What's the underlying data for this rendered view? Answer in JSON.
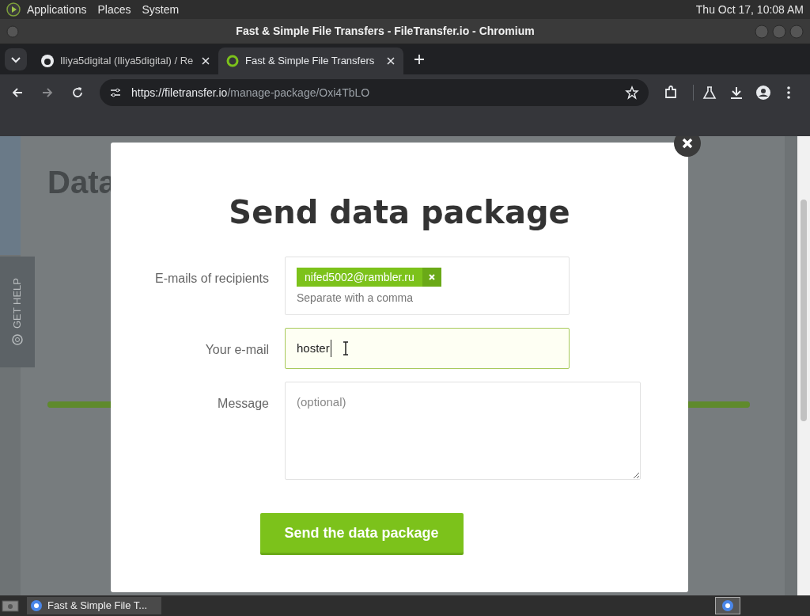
{
  "top_panel": {
    "menus": [
      "Applications",
      "Places",
      "System"
    ],
    "clock": "Thu Oct 17, 10:08 AM"
  },
  "window": {
    "title": "Fast & Simple File Transfers - FileTransfer.io - Chromium"
  },
  "tabs": [
    {
      "label": "Iliya5digital (Iliya5digital) / Re",
      "selected": false,
      "kind": "github"
    },
    {
      "label": "Fast & Simple File Transfers",
      "selected": true,
      "kind": "site"
    }
  ],
  "address_bar": {
    "host": "https://filetransfer.io",
    "path": "/manage-package/Oxi4TbLO"
  },
  "background_page": {
    "heading": "Data",
    "help_tab": "GET HELP",
    "progress": {
      "level": 1
    }
  },
  "dialog": {
    "title": "Send data package",
    "fields": [
      {
        "label": "E-mails of recipients",
        "kind": "tags",
        "tags": [
          "nifed5002@rambler.ru"
        ],
        "hint": "Separate with a comma"
      },
      {
        "label": "Your e-mail",
        "kind": "input",
        "value": "hoster",
        "focused": true
      },
      {
        "label": "Message",
        "kind": "textarea",
        "placeholder": "(optional)"
      }
    ],
    "submit": "Send the data package"
  },
  "taskbar": {
    "tasks": [
      {
        "label": "Fast & Simple File T...",
        "selected": true
      }
    ]
  }
}
